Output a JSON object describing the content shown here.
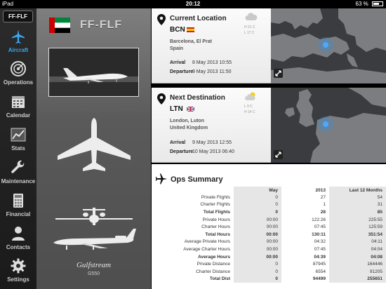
{
  "status": {
    "device": "iPad",
    "time": "20:12",
    "battery": "63 %",
    "battery_level": 0.63
  },
  "sidebar": {
    "badge": "FF-FLF",
    "items": [
      {
        "label": "Aircraft",
        "icon": "airplane-icon",
        "active": true
      },
      {
        "label": "Operations",
        "icon": "radar-icon"
      },
      {
        "label": "Calendar",
        "icon": "calendar-icon"
      },
      {
        "label": "Stats",
        "icon": "chart-icon"
      },
      {
        "label": "Maintenance",
        "icon": "wrench-icon"
      },
      {
        "label": "Financial",
        "icon": "calculator-icon"
      },
      {
        "label": "Contacts",
        "icon": "person-icon"
      },
      {
        "label": "Settings",
        "icon": "gear-icon"
      }
    ]
  },
  "aircraft": {
    "registration": "FF-FLF",
    "maker": "Gulfstream",
    "model": "G550",
    "flag_colors": {
      "green": "#00843d",
      "white": "#ffffff",
      "black": "#000000",
      "red": "#cc0000"
    }
  },
  "current": {
    "title": "Current Location",
    "code": "BCN",
    "place_line1": "Barcelona, El Prat",
    "place_line2": "Spain",
    "arrival_label": "Arrival",
    "arrival_value": "8 May 2013 10:55",
    "departure_label": "Departure",
    "departure_value": "9 May 2013 11:50",
    "temp_high": "H 21 C",
    "temp_low": "L 17 C"
  },
  "next": {
    "title": "Next Destination",
    "code": "LTN",
    "place_line1": "London, Luton",
    "place_line2": "United Kingdom",
    "arrival_label": "Arrival",
    "arrival_value": "9 May 2013 12:55",
    "departure_label": "Departure",
    "departure_value": "10 May 2013 06:40",
    "temp_low": "L 9 C",
    "temp_high": "H 14 C"
  },
  "ops": {
    "title": "Ops Summary",
    "columns": [
      "May",
      "2013",
      "Last 12 Months"
    ],
    "rows": [
      {
        "label": "Private Flights",
        "v": [
          "0",
          "27",
          "54"
        ]
      },
      {
        "label": "Charter Flights",
        "v": [
          "0",
          "1",
          "31"
        ]
      },
      {
        "label": "Total Flights",
        "v": [
          "0",
          "28",
          "85"
        ],
        "bold": true
      },
      {
        "label": "Private Hours",
        "v": [
          "00:00",
          "122:26",
          "225:55"
        ]
      },
      {
        "label": "Charter Hours",
        "v": [
          "00:00",
          "07:45",
          "125:59"
        ]
      },
      {
        "label": "Total Hours",
        "v": [
          "00:00",
          "130:11",
          "351:54"
        ],
        "bold": true
      },
      {
        "label": "Average Private Hours",
        "v": [
          "00:00",
          "04:32",
          "04:11"
        ]
      },
      {
        "label": "Average Charter Hours",
        "v": [
          "00:00",
          "07:45",
          "04:04"
        ]
      },
      {
        "label": "Average Hours",
        "v": [
          "00:00",
          "04:39",
          "04:08"
        ],
        "bold": true
      },
      {
        "label": "Private Distance",
        "v": [
          "0",
          "87945",
          "164446"
        ]
      },
      {
        "label": "Charter Distance",
        "v": [
          "0",
          "6554",
          "91205"
        ]
      },
      {
        "label": "Total Dist",
        "v": [
          "0",
          "94499",
          "255651"
        ],
        "bold": true
      }
    ]
  }
}
